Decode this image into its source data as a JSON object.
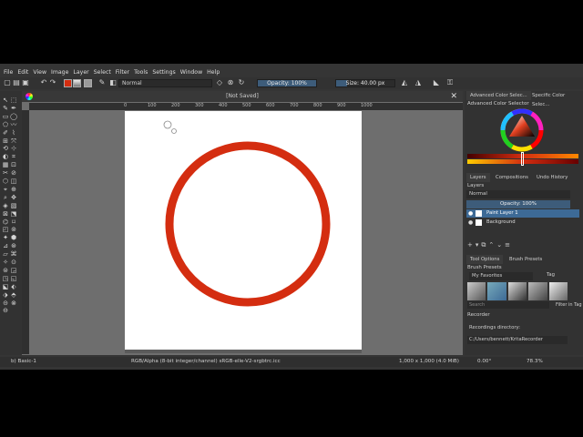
{
  "menu": [
    "File",
    "Edit",
    "View",
    "Image",
    "Layer",
    "Select",
    "Filter",
    "Tools",
    "Settings",
    "Window",
    "Help"
  ],
  "toolbar": {
    "blend_mode": "Normal",
    "opacity_label": "Opacity: 100%",
    "opacity_value": 1.0,
    "size_label": "Size: 40.00 px"
  },
  "document": {
    "tab_title": "[Not Saved]",
    "ruler_labels": [
      "0",
      "100",
      "200",
      "300",
      "400",
      "500",
      "600",
      "700",
      "800",
      "900",
      "1000"
    ]
  },
  "dock": {
    "tabs_top": [
      "Advanced Color Selec...",
      "Specific Color Selec..."
    ],
    "advanced_color_selector": "Advanced Color Selector",
    "tabs_mid": [
      "Layers",
      "Compositions",
      "Undo History"
    ],
    "layers_title": "Layers",
    "layers_blend": "Normal",
    "layers_opacity": "Opacity: 100%",
    "layers": [
      {
        "name": "Paint Layer 1",
        "selected": true
      },
      {
        "name": "Background",
        "selected": false
      }
    ],
    "tabs_low": [
      "Tool Options",
      "Brush Presets"
    ],
    "brush_presets_title": "Brush Presets",
    "favorites": "My Favorites",
    "tag": "Tag",
    "search_placeholder": "Search",
    "filter_in_tag": "Filter in Tag",
    "recorder_title": "Recorder",
    "recordings_directory_label": "Recordings directory:",
    "recordings_path": "C:/Users/bennett/KritaRecorder"
  },
  "status": {
    "brush": "b) Basic-1",
    "color_space": "RGB/Alpha (8-bit integer/channel)  sRGB-elle-V2-srgbtrc.icc",
    "dimensions": "1,000 x 1,000 (4.0 MiB)",
    "rotation": "0.00°",
    "zoom": "78.3%"
  },
  "colors": {
    "circle_stroke": "#d42d10",
    "accent": "#3d5c7a",
    "selected_layer": "#3d6a96"
  }
}
